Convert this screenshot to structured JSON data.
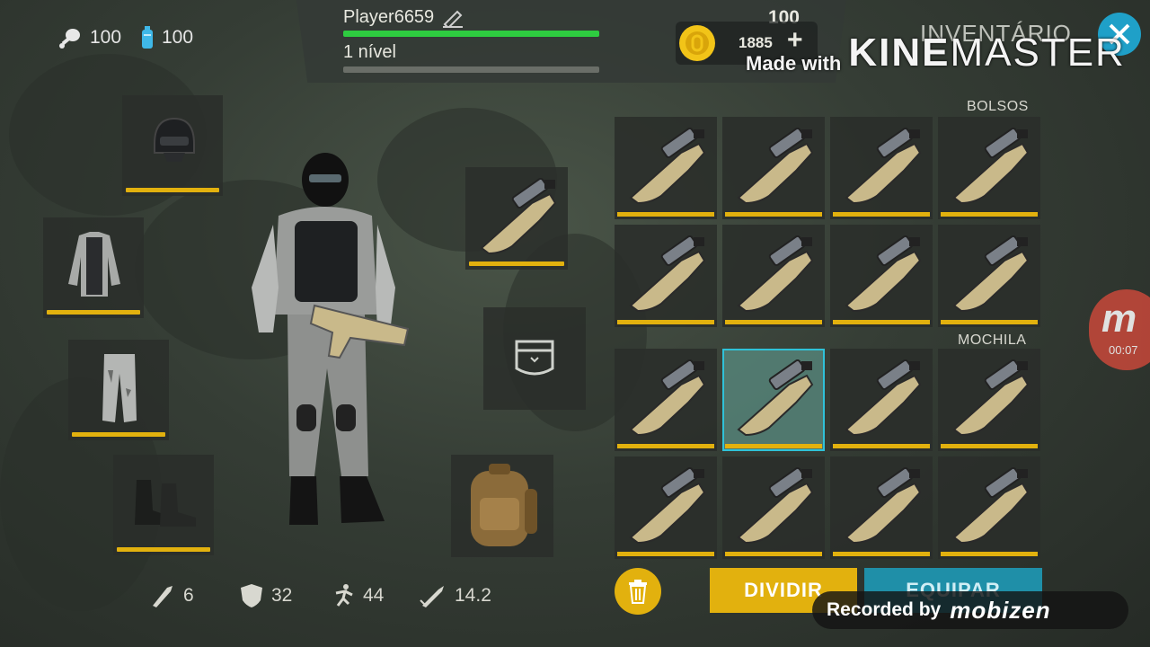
{
  "top_stats": {
    "food": "100",
    "water": "100"
  },
  "player": {
    "name": "Player6659",
    "health": "100",
    "level_label": "1 nível"
  },
  "currency": {
    "coins": "1885",
    "add": "+"
  },
  "inventory": {
    "title": "INVENTÁRIO",
    "pockets_label": "BOLSOS",
    "backpack_label": "MOCHILA"
  },
  "bottom_stats": {
    "attack": "6",
    "armor": "32",
    "speed": "44",
    "range": "14.2"
  },
  "buttons": {
    "split": "DIVIDIR",
    "equip": "EQUIPAR"
  },
  "overlays": {
    "watermark_made": "Made with",
    "watermark_brand_a": "KINE",
    "watermark_brand_b": "MASTER",
    "recorded_by": "Recorded by",
    "recorder_brand": "mobizen",
    "rec_badge_letter": "m",
    "rec_time": "00:07"
  },
  "colors": {
    "accent_yellow": "#e2b10e",
    "health_green": "#2ecc40",
    "equip_teal": "#1f8fa8",
    "selected_cyan": "#2fc2d8"
  }
}
